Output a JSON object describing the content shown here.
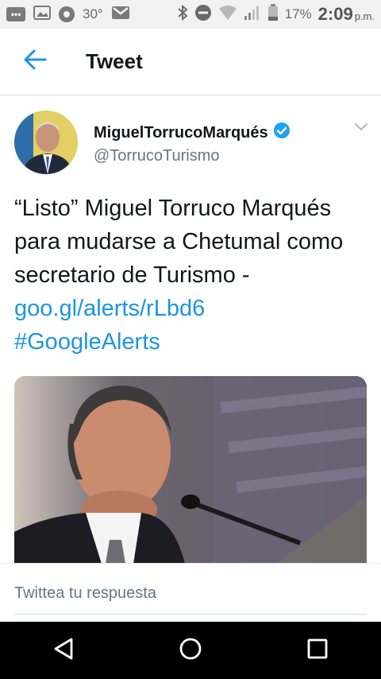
{
  "status_bar": {
    "temperature": "30°",
    "battery": "17%",
    "time": "2:09",
    "ampm": "p.m.",
    "icons": [
      "messages-icon",
      "gallery-icon",
      "chrome-icon",
      "gmail-icon",
      "bluetooth-icon",
      "do-not-disturb-icon",
      "wifi-icon",
      "signal-icon",
      "battery-icon"
    ]
  },
  "appbar": {
    "title": "Tweet",
    "back_icon": "arrow-left-icon"
  },
  "tweet": {
    "display_name": "MiguelTorrucoMarqués",
    "handle": "@TorrucoTurismo",
    "text_plain": "“Listo” Miguel Torruco Marqués para mudarse a Chetumal como secretario de Turismo - ",
    "link": "goo.gl/alerts/rLbd6",
    "hashtag": "#GoogleAlerts"
  },
  "reply": {
    "placeholder": "Twittea tu respuesta"
  },
  "colors": {
    "accent": "#1b95e0",
    "text": "#14171a",
    "secondary": "#657786"
  }
}
